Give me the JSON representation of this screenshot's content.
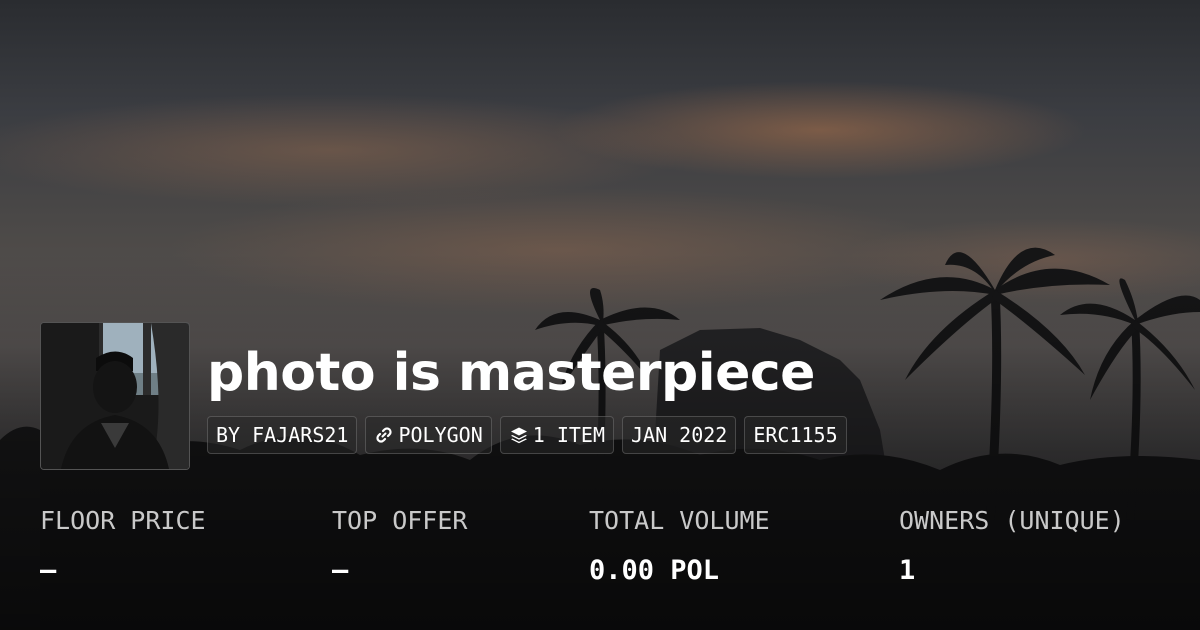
{
  "collection": {
    "title": "photo is masterpiece",
    "tags": {
      "creator": "BY FAJARS21",
      "chain": "POLYGON",
      "items": "1 ITEM",
      "date": "JAN 2022",
      "standard": "ERC1155"
    }
  },
  "stats": [
    {
      "label": "FLOOR PRICE",
      "value": "–"
    },
    {
      "label": "TOP OFFER",
      "value": "–"
    },
    {
      "label": "TOTAL VOLUME",
      "value": "0.00 POL"
    },
    {
      "label": "OWNERS (UNIQUE)",
      "value": "1"
    }
  ],
  "icons": {
    "chain": "link-icon",
    "items": "layers-icon"
  }
}
